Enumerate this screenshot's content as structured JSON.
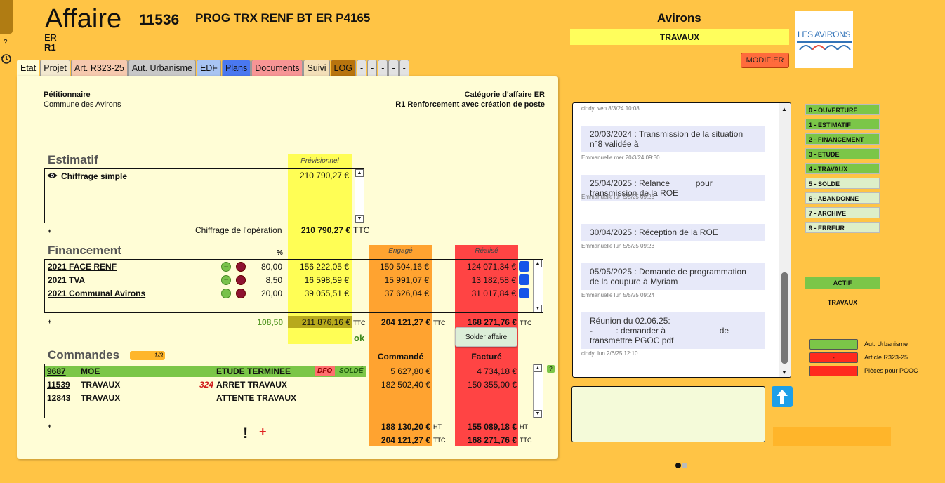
{
  "header": {
    "help": "?",
    "title": "Affaire",
    "number": "11536",
    "name": "PROG TRX RENF BT ER P4165",
    "sub1": "ER",
    "sub2": "R1"
  },
  "tabs": [
    {
      "label": "Etat",
      "color": "#FFFDD6"
    },
    {
      "label": "Projet",
      "color": "#F2E8CF"
    },
    {
      "label": "Art. R323-25",
      "color": "#F6C9AE"
    },
    {
      "label": "Aut. Urbanisme",
      "color": "#C8C8C8"
    },
    {
      "label": "EDF",
      "color": "#A8C4F2"
    },
    {
      "label": "Plans",
      "color": "#4A78F0"
    },
    {
      "label": "Documents",
      "color": "#F79595"
    },
    {
      "label": "Suivi",
      "color": "#F3DFB8"
    },
    {
      "label": "LOG",
      "color": "#B8740E"
    },
    {
      "label": "-",
      "color": "#E2E2E2"
    },
    {
      "label": "-",
      "color": "#E2E2E2"
    },
    {
      "label": "-",
      "color": "#E2E2E2"
    },
    {
      "label": "-",
      "color": "#E2E2E2"
    },
    {
      "label": "-",
      "color": "#E2E2E2"
    }
  ],
  "info": {
    "petitionnaire_label": "Pétitionnaire",
    "petitionnaire_value": "Commune des Avirons",
    "categorie_label": "Catégorie d'affaire ER",
    "categorie_value": "R1 Renforcement avec création de poste"
  },
  "estimatif": {
    "title": "Estimatif",
    "prev_header": "Prévisionnel",
    "item_label": "Chiffrage simple",
    "item_value": "210 790,27 €",
    "plus": "+",
    "total_label": "Chiffrage de l'opération",
    "total_value": "210 790,27 €",
    "total_unit": "TTC"
  },
  "financement": {
    "title": "Financement",
    "pct_header": "%",
    "engage_header": "Engagé",
    "realise_header": "Réalisé",
    "rows": [
      {
        "label": "2021 FACE RENF",
        "pct": "80,00",
        "prev": "156 222,05 €",
        "engage": "150 504,16 €",
        "realise": "124 071,34 €"
      },
      {
        "label": "2021 TVA",
        "pct": "8,50",
        "prev": "16 598,59 €",
        "engage": "15 991,07 €",
        "realise": "13 182,58 €"
      },
      {
        "label": "2021 Communal Avirons",
        "pct": "20,00",
        "prev": "39 055,51 €",
        "engage": "37 626,04 €",
        "realise": "31 017,84 €"
      }
    ],
    "dot_label": "...",
    "plus": "+",
    "total_pct": "108,50",
    "total_prev": "211 876,16 €",
    "total_engage": "204 121,27 €",
    "total_realise": "168 271,76 €",
    "unit": "TTC",
    "ok": "ok",
    "solder_btn": "Solder affaire"
  },
  "commandes": {
    "title": "Commandes",
    "pager": "1/3",
    "commande_header": "Commandé",
    "facture_header": "Facturé",
    "help": "?",
    "rows": [
      {
        "id": "9687",
        "type": "MOE",
        "flag": "",
        "status": "ETUDE TERMINEE",
        "dfo": "DFO",
        "solde": "SOLDÉ",
        "commande": "5 627,80 €",
        "facture": "4 734,18 €"
      },
      {
        "id": "11539",
        "type": "TRAVAUX",
        "flag": "324",
        "status": "ARRET TRAVAUX",
        "dfo": "",
        "solde": "",
        "commande": "182 502,40 €",
        "facture": "150 355,00 €"
      },
      {
        "id": "12843",
        "type": "TRAVAUX",
        "flag": "",
        "status": "ATTENTE TRAVAUX",
        "dfo": "",
        "solde": "",
        "commande": "",
        "facture": ""
      }
    ],
    "plus": "+",
    "excl": "!",
    "add": "+",
    "ht_commande": "188 130,20 €",
    "ht_facture": "155 089,18 €",
    "ttc_commande": "204 121,27 €",
    "ttc_facture": "168 271,76 €",
    "ht": "HT",
    "ttc": "TTC"
  },
  "right": {
    "title": "Avirons",
    "phase": "TRAVAUX",
    "modifier": "MODIFIER",
    "logo_text": "LES AVIRONS"
  },
  "chat": {
    "top_meta": "cindyt ven 8/3/24 10:08",
    "messages": [
      {
        "text": "20/03/2024 : Transmission de la situation n°8 validée à",
        "meta": "Emmanuelle mer 20/3/24 09:30"
      },
      {
        "text": "25/04/2025 : Relance           pour transmission de la ROE",
        "meta": "Emmanuelle lun 5/5/25 09:23"
      },
      {
        "text": "30/04/2025 : Réception de la ROE",
        "meta": "Emmanuelle lun 5/5/25 09:23"
      },
      {
        "text": "05/05/2025 : Demande de programmation de la coupure à Myriam",
        "meta": "Emmanuelle lun 5/5/25 09:24"
      },
      {
        "text": "Réunion du 02.06.25:\n-          : demander à                       de transmettre PGOC pdf",
        "meta": "cindyt lun 2/6/25 12:10"
      }
    ]
  },
  "statuses": [
    {
      "label": "0 - OUVERTURE",
      "done": true
    },
    {
      "label": "1 - ESTIMATIF",
      "done": true
    },
    {
      "label": "2 - FINANCEMENT",
      "done": true
    },
    {
      "label": "3 - ETUDE",
      "done": true
    },
    {
      "label": "4 - TRAVAUX",
      "done": true
    },
    {
      "label": "5 - SOLDE",
      "done": false
    },
    {
      "label": "6 - ABANDONNE",
      "done": false
    },
    {
      "label": "7 - ARCHIVE",
      "done": false
    },
    {
      "label": "9 - ERREUR",
      "done": false
    }
  ],
  "actif": "ACTIF",
  "actif_sub": "TRAVAUX",
  "legend": [
    {
      "swatch": "",
      "label": "Aut. Urbanisme",
      "color": "#7BC648"
    },
    {
      "swatch": "-",
      "label": "Article R323-25",
      "color": "#FF2A1E"
    },
    {
      "swatch": "",
      "label": "Pièces pour PGOC",
      "color": "#FF2A1E"
    }
  ],
  "colors": {
    "background": "#FFC445",
    "panel": "#FFFDD6",
    "previsionnel": "#FFFE55",
    "engage": "#FFA330",
    "realise": "#FF4444"
  }
}
